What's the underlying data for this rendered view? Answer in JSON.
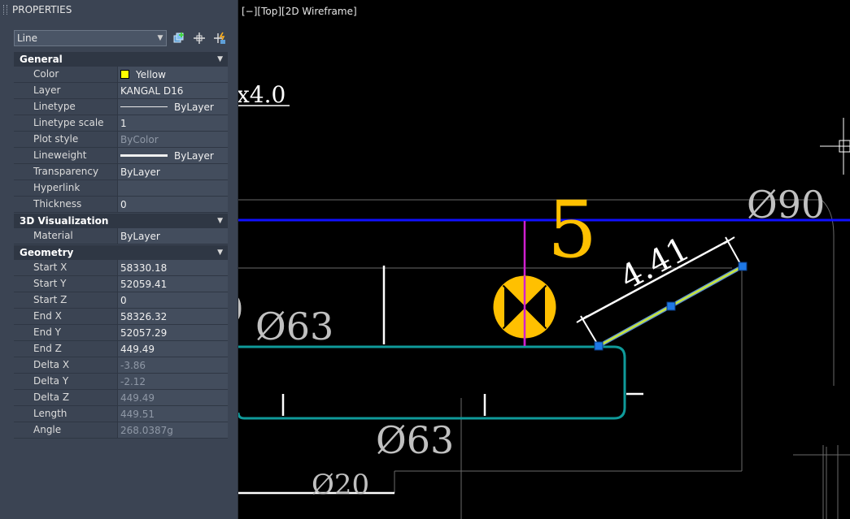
{
  "palette": {
    "title": "PROPERTIES",
    "object_type": "Line",
    "sections": [
      {
        "name": "General",
        "rows": [
          {
            "label": "Color",
            "value": "Yellow"
          },
          {
            "label": "Layer",
            "value": "KANGAL D16"
          },
          {
            "label": "Linetype",
            "value": "ByLayer"
          },
          {
            "label": "Linetype scale",
            "value": "1"
          },
          {
            "label": "Plot style",
            "value": "ByColor"
          },
          {
            "label": "Lineweight",
            "value": "ByLayer"
          },
          {
            "label": "Transparency",
            "value": "ByLayer"
          },
          {
            "label": "Hyperlink",
            "value": ""
          },
          {
            "label": "Thickness",
            "value": "0"
          }
        ]
      },
      {
        "name": "3D Visualization",
        "rows": [
          {
            "label": "Material",
            "value": "ByLayer"
          }
        ]
      },
      {
        "name": "Geometry",
        "rows": [
          {
            "label": "Start X",
            "value": "58330.18"
          },
          {
            "label": "Start Y",
            "value": "52059.41"
          },
          {
            "label": "Start Z",
            "value": "0"
          },
          {
            "label": "End X",
            "value": "58326.32"
          },
          {
            "label": "End Y",
            "value": "52057.29"
          },
          {
            "label": "End Z",
            "value": "449.49"
          },
          {
            "label": "Delta X",
            "value": "-3.86"
          },
          {
            "label": "Delta Y",
            "value": "-2.12"
          },
          {
            "label": "Delta Z",
            "value": "449.49"
          },
          {
            "label": "Length",
            "value": "449.51"
          },
          {
            "label": "Angle",
            "value": "268.0387g"
          }
        ]
      }
    ]
  },
  "viewport": {
    "label": "[−][Top][2D Wireframe]",
    "annotations": {
      "scale_text": "x4.0",
      "bar_mark": "5",
      "dia_90": "Ø90",
      "dia_63_top": "Ø63",
      "dia_63_bottom": "Ø63",
      "dia_20": "Ø20",
      "dimension": "4.41"
    }
  },
  "colors": {
    "palette_bg": "#3b4453",
    "value_bg": "#434d5d",
    "section_bg": "#2f3744",
    "blue_line": "#1010ff",
    "cyan_bar": "#0f9a9a",
    "yellow_mark": "#ffc000",
    "magenta": "#d020d0",
    "grip_blue": "#1e78e6",
    "selected_line": "#c8e63c"
  }
}
